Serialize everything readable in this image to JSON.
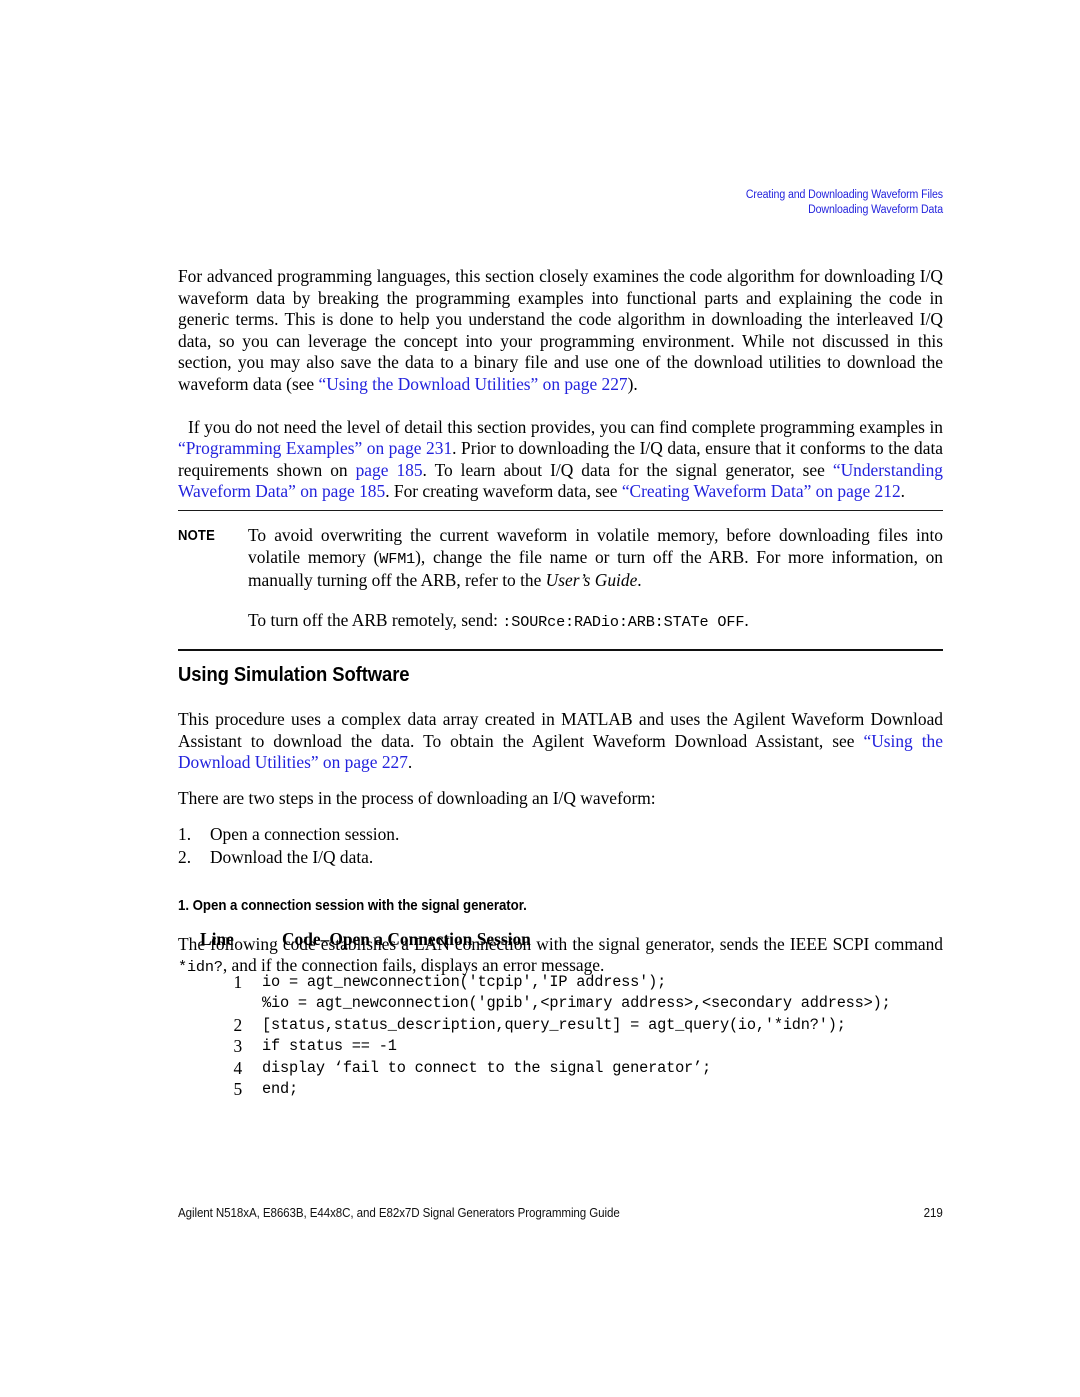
{
  "header": {
    "line1": "Creating and Downloading Waveform Files",
    "line2": "Downloading Waveform Data",
    "color": "#2323dd"
  },
  "paragraph1": {
    "t1": "For advanced programming languages, this section closely examines the code algorithm for downloading I/Q waveform data by breaking the programming examples into functional parts and explaining the code in generic terms. This is done to help you understand the code algorithm in downloading the interleaved I/Q data, so you can leverage the concept into your programming environment. While not discussed in this section, you may also save the data to a binary file and use one of the download utilities to download the waveform data (see ",
    "link1": "“Using the Download Utilities” on page 227",
    "t2": ")."
  },
  "paragraph2": {
    "t1": "If you do not need the level of detail this section provides, you can find complete programming examples in ",
    "link1": "“Programming Examples” on page 231",
    "t2": ". Prior to downloading the I/Q data, ensure that it conforms to the data requirements shown on ",
    "link2": "page 185",
    "t3": ". To learn about I/Q data for the signal generator, see ",
    "link3": "“Understanding Waveform Data” on page 185",
    "t4": ". For creating waveform data, see ",
    "link4": "“Creating Waveform Data” on page 212",
    "t5": "."
  },
  "note": {
    "label": "NOTE",
    "p1_a": "To avoid overwriting the current waveform in volatile memory, before downloading files into volatile memory (",
    "p1_mono": "WFM1",
    "p1_b": "), change the file name or turn off the ARB. For more information, on manually turning off the ARB, refer to the ",
    "p1_italic": "User’s Guide",
    "p1_c": ".",
    "p2_a": "To turn off the ARB remotely, send: ",
    "p2_mono": ":SOURce:RADio:ARB:STATe OFF",
    "p2_b": "."
  },
  "section": {
    "heading": "Using Simulation Software",
    "p1_a": "This procedure uses a complex data array created in MATLAB and uses the Agilent Waveform Download Assistant to download the data. To obtain the Agilent Waveform Download Assistant, see ",
    "p1_link": "“Using the Download Utilities” on page 227",
    "p1_b": ".",
    "p2": "There are two steps in the process of downloading an I/Q waveform:",
    "steps": [
      {
        "num": "1.",
        "text": "Open a connection session."
      },
      {
        "num": "2.",
        "text": "Download the I/Q data."
      }
    ],
    "subheading": "1. Open a connection session with the signal generator.",
    "p3_a": "The following code establishes a LAN connection with the signal generator, sends the IEEE SCPI command ",
    "p3_mono": "*idn?",
    "p3_b": ", and if the connection fails, displays an error message."
  },
  "code_table": {
    "col_line": "Line",
    "col_code": "Code–Open a Connection Session",
    "rows": [
      {
        "line": "1",
        "code": "io = agt_newconnection('tcpip','IP address');"
      },
      {
        "line": "",
        "code": "%io = agt_newconnection('gpib',<primary address>,<secondary address>);"
      },
      {
        "line": "2",
        "code": "[status,status_description,query_result] = agt_query(io,'*idn?');"
      },
      {
        "line": "3",
        "code": "if status == -1"
      },
      {
        "line": "4",
        "code": "display ‘fail to connect to the signal generator’;"
      },
      {
        "line": "5",
        "code": "end;"
      }
    ]
  },
  "footer": {
    "text": "Agilent N518xA, E8663B, E44x8C, and E82x7D Signal Generators Programming Guide",
    "page": "219"
  }
}
